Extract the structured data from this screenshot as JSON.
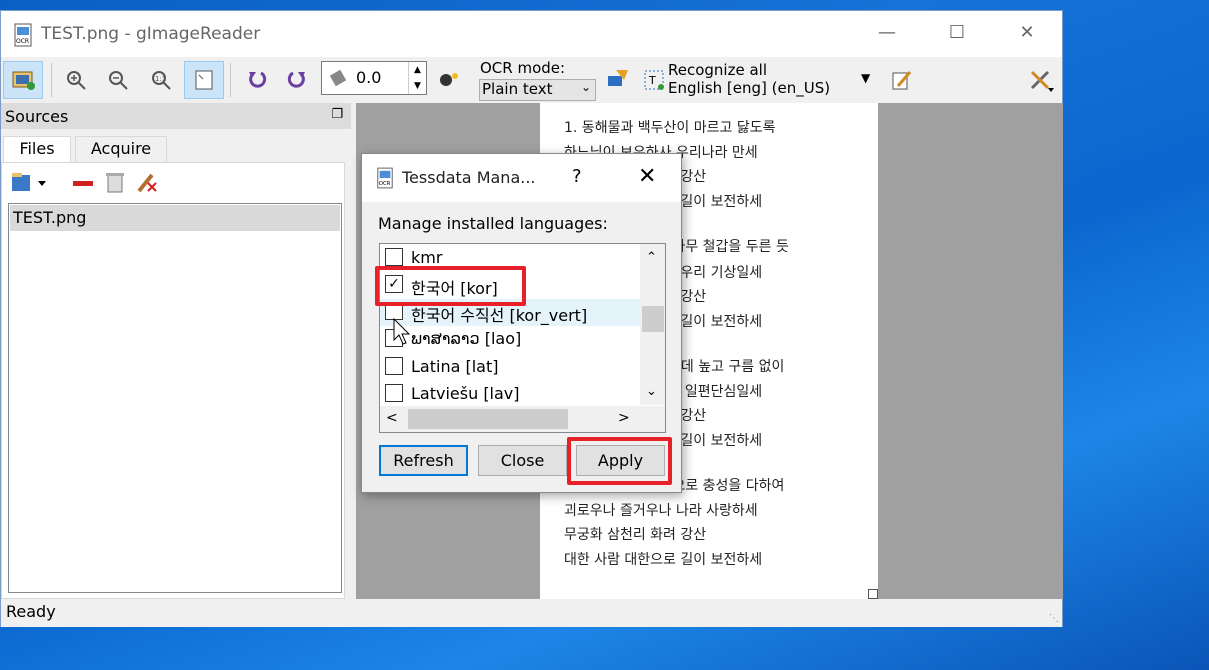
{
  "window": {
    "title": "TEST.png - gImageReader"
  },
  "toolbar": {
    "rotation_value": "0.0",
    "ocr_mode_label": "OCR mode:",
    "ocr_mode_value": "Plain text",
    "recognize_label": "Recognize all",
    "language_label": "English [eng] (en_US)"
  },
  "sources": {
    "title": "Sources",
    "tabs": [
      "Files",
      "Acquire"
    ],
    "files": [
      "TEST.png"
    ]
  },
  "document": {
    "lines": [
      "1. 동해물과 백두산이 마르고 닳도록",
      "하느님이 보우하사 우리나라 만세",
      "무궁화 삼천리 화려 강산",
      "대한 사람 대한으로 길이 보전하세",
      "2. 남산 위에 저 소나무 철갑을 두른 듯",
      "바람 서리 불변함은 우리 기상일세",
      "무궁화 삼천리 화려 강산",
      "대한 사람 대한으로 길이 보전하세",
      "3. 가을 하늘 공활한데 높고 구름 없이",
      "밝은 달은 우리 가슴 일편단심일세",
      "무궁화 삼천리 화려 강산",
      "대한 사람 대한으로 길이 보전하세",
      "4. 이 기상과 이 맘으로 충성을 다하여",
      "괴로우나 즐거우나 나라 사랑하세",
      "무궁화 삼천리 화려 강산",
      "대한 사람 대한으로 길이 보전하세"
    ]
  },
  "status": {
    "text": "Ready"
  },
  "dialog": {
    "title": "Tessdata Mana...",
    "help": "?",
    "label": "Manage installed languages:",
    "languages": [
      {
        "name": "kmr",
        "checked": false
      },
      {
        "name": "한국어 [kor]",
        "checked": true
      },
      {
        "name": "한국어 수직선 [kor_vert]",
        "checked": false
      },
      {
        "name": "ພາສາລາວ [lao]",
        "checked": false
      },
      {
        "name": "Latina [lat]",
        "checked": false
      },
      {
        "name": "Latviešu [lav]",
        "checked": false
      }
    ],
    "buttons": {
      "refresh": "Refresh",
      "close": "Close",
      "apply": "Apply"
    }
  },
  "colors": {
    "highlight": "#e8202a",
    "desktop": "#0b67cf",
    "default_button_border": "#0078d7"
  }
}
